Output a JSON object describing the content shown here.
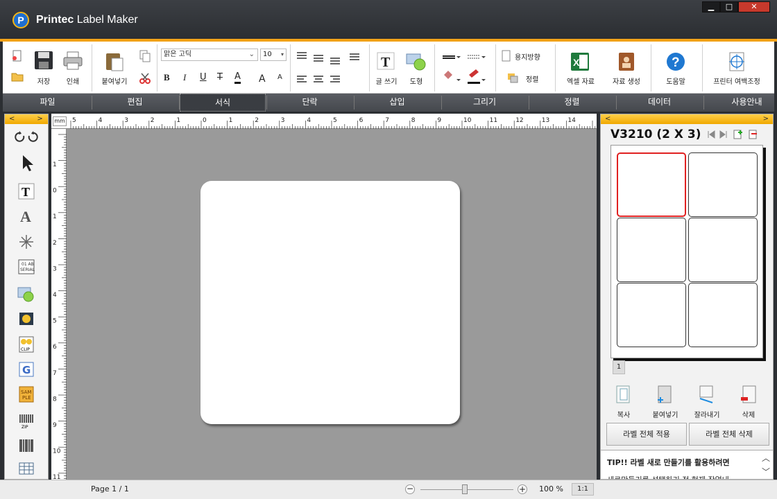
{
  "window": {
    "title_bold": "Printec",
    "title_rest": " Label Maker",
    "logo_letter": "P",
    "min": "▁",
    "max": "□",
    "close": "✕"
  },
  "ribbon": {
    "save": "저장",
    "print": "인쇄",
    "paste": "붙여넣기",
    "font_name": "맑은 고딕",
    "font_size": "10",
    "bold": "B",
    "italic": "I",
    "underline": "U",
    "strike": "T",
    "fontcolor": "A",
    "grow": "A",
    "shrink": "A",
    "text": "글 쓰기",
    "shape": "도형",
    "orientation": "용지방향",
    "align": "정렬",
    "excel": "엑셀 자료",
    "data_gen": "자료 생성",
    "help": "도움말",
    "margin": "프린터 여백조정"
  },
  "tabs": [
    "파일",
    "편집",
    "서식",
    "단락",
    "삽입",
    "그리기",
    "정렬",
    "데이터",
    "사용안내"
  ],
  "ruler": {
    "unit": "mm",
    "top_labels": [
      "5",
      "4",
      "3",
      "2",
      "1",
      "0",
      "1",
      "2",
      "3",
      "4",
      "5",
      "6",
      "7",
      "8",
      "9",
      "10",
      "11",
      "12",
      "13",
      "14"
    ],
    "left_labels": [
      "1",
      "0",
      "1",
      "2",
      "3",
      "4",
      "5",
      "6",
      "7",
      "8",
      "9",
      "10",
      "11"
    ]
  },
  "right_panel": {
    "sheet_title": "V3210 (2 X 3)",
    "page_num": "1",
    "copy": "복사",
    "paste": "붙여넣기",
    "cut": "잘라내기",
    "delete": "삭제",
    "apply_all": "라벨 전체 적용",
    "delete_all": "라벨 전체 삭제",
    "tip_title": "TIP!! 라벨 새로 만들기를 활용하려면",
    "tip_body": "새로만들기를 선택하기 전 현재 작업내"
  },
  "status": {
    "page": "Page 1 / 1",
    "zoom": "100 %",
    "ratio": "1:1",
    "zoom_level": 0.45
  },
  "colors": {
    "accent": "#f2a217",
    "selected_cell": "#e02020"
  }
}
